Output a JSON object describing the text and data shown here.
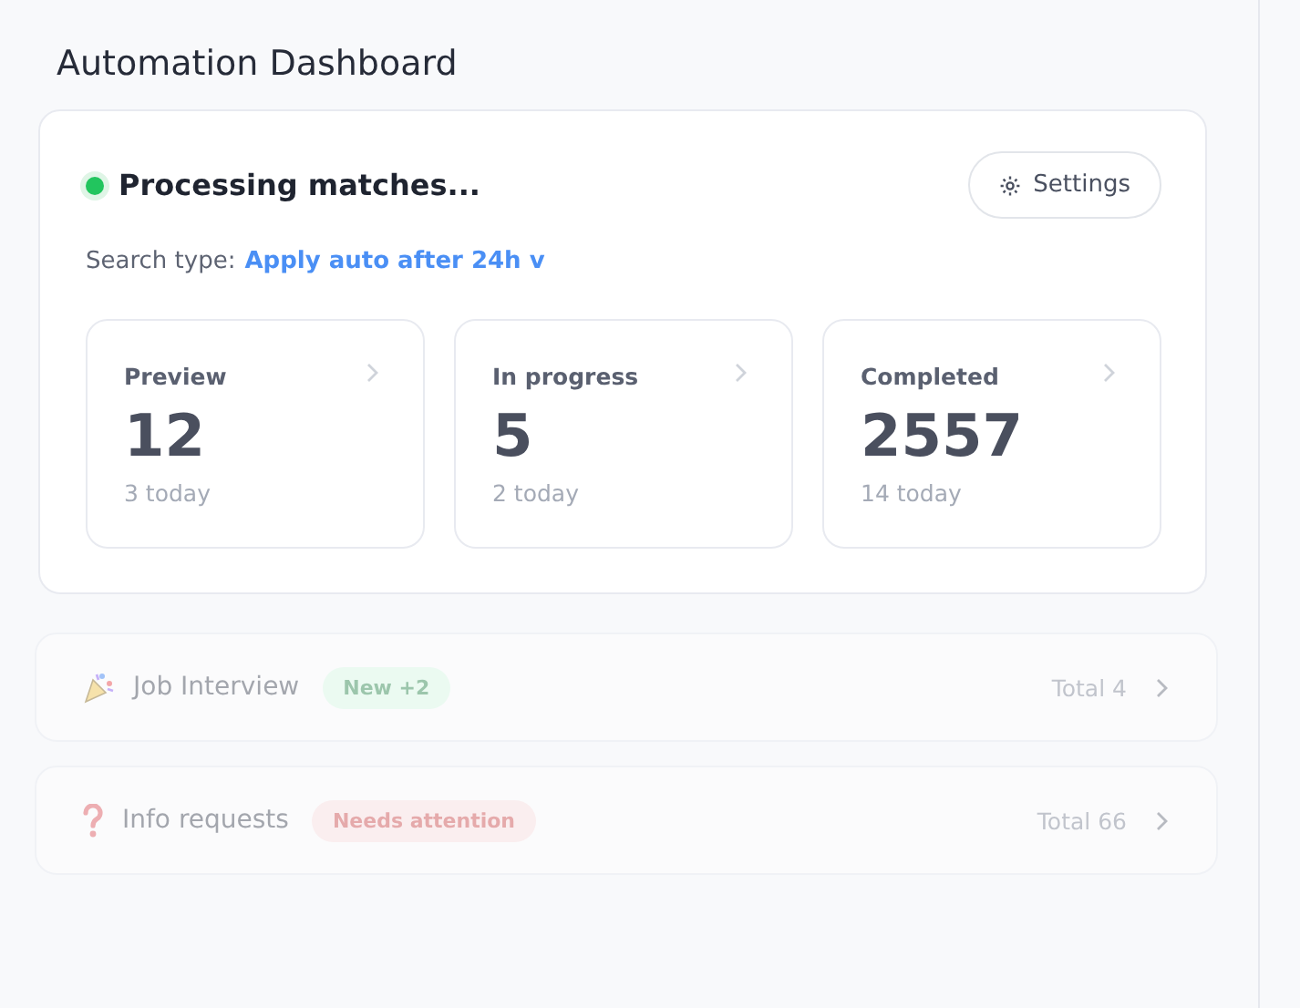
{
  "title": "Automation Dashboard",
  "status": {
    "label": "Processing matches...",
    "active": true
  },
  "settings_button": "Settings",
  "search_type": {
    "label": "Search type:",
    "value": "Apply auto after 24h",
    "caret": "v"
  },
  "stats": [
    {
      "label": "Preview",
      "value": "12",
      "today": "3 today"
    },
    {
      "label": "In progress",
      "value": "5",
      "today": "2 today"
    },
    {
      "label": "Completed",
      "value": "2557",
      "today": "14 today"
    }
  ],
  "groups": [
    {
      "kind": "party",
      "name": "Job Interview",
      "badge": {
        "text": "New +2",
        "kind": "success"
      },
      "total": "Total 4"
    },
    {
      "kind": "question",
      "name": "Info requests",
      "badge": {
        "text": "Needs attention",
        "kind": "danger"
      },
      "total": "Total 66"
    }
  ]
}
